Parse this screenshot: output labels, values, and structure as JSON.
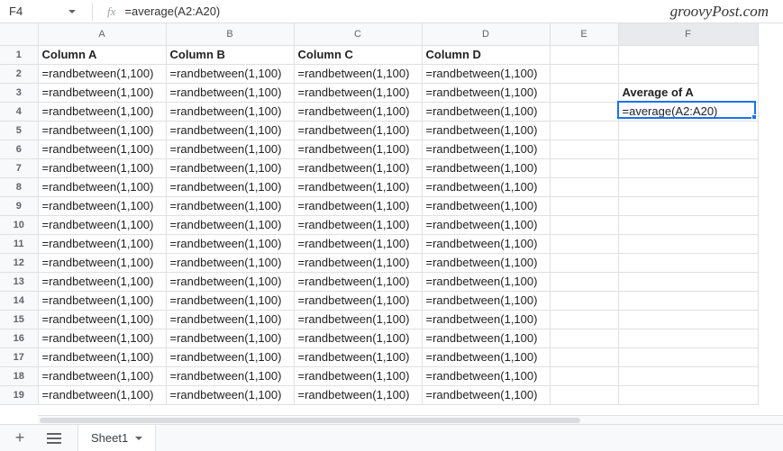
{
  "formula_bar": {
    "cell_ref": "F4",
    "formula": "=average(A2:A20)"
  },
  "watermark": "groovyPost.com",
  "columns": [
    "A",
    "B",
    "C",
    "D",
    "E",
    "F"
  ],
  "rows_visible": 19,
  "headers": {
    "A": "Column A",
    "B": "Column B",
    "C": "Column C",
    "D": "Column D"
  },
  "data_formula": "=randbetween(1,100)",
  "fcol": {
    "label_row": 3,
    "label": "Average of A",
    "value_row": 4,
    "value": "=average(A2:A20)"
  },
  "selected_cell": "F4",
  "sheet_tabs": {
    "add": "+",
    "active": "Sheet1"
  }
}
